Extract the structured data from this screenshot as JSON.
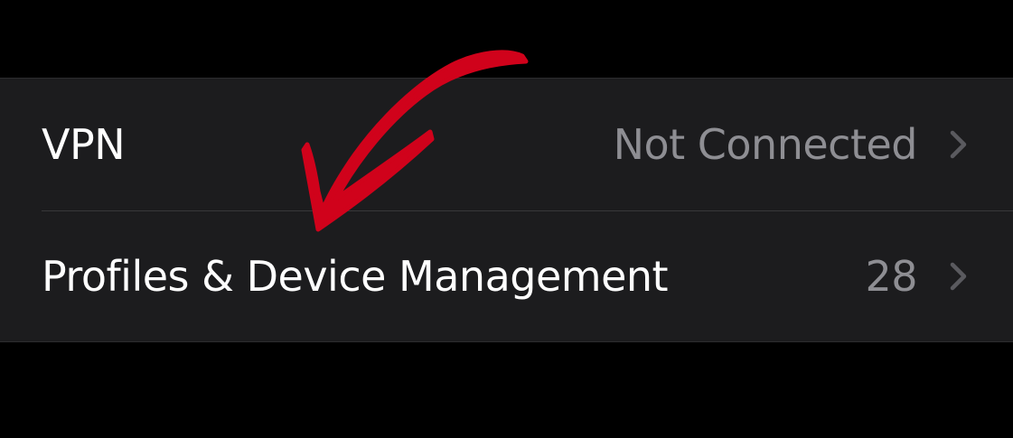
{
  "settings_group": {
    "rows": [
      {
        "title": "VPN",
        "value": "Not Connected",
        "accessory_icon": "chevron-right-icon"
      },
      {
        "title": "Profiles & Device Management",
        "value": "28",
        "accessory_icon": "chevron-right-icon"
      }
    ]
  },
  "annotation": {
    "icon": "hand-drawn-arrow-icon",
    "color": "#d0021b"
  },
  "colors": {
    "background": "#000000",
    "cell_background": "#1c1c1e",
    "title_text": "#ffffff",
    "value_text": "#8e8e93",
    "chevron": "#5a5a5f",
    "separator": "#38383a"
  }
}
